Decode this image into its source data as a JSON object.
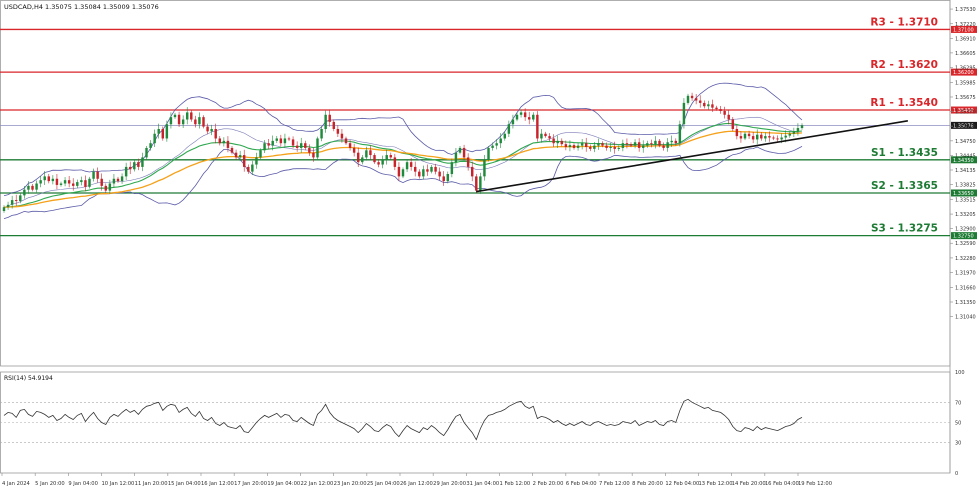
{
  "header": {
    "symbol_ohlc": "USDCAD,H4  1.35075 1.35084 1.35009 1.35076"
  },
  "chart_data": {
    "type": "candlestick",
    "price_axis": {
      "ylim": [
        1.3,
        1.377
      ],
      "ticks": [
        "1.37530",
        "1.37220",
        "1.36910",
        "1.36605",
        "1.36295",
        "1.35985",
        "1.35675",
        "1.35370",
        "1.35060",
        "1.34750",
        "1.34445",
        "1.34135",
        "1.33825",
        "1.33515",
        "1.33205",
        "1.32900",
        "1.32590",
        "1.32280",
        "1.31970",
        "1.31660",
        "1.31350",
        "1.31040"
      ],
      "current_price": "1.35076"
    },
    "levels": [
      {
        "label": "R3 - 1.3710",
        "value": 1.371,
        "tag": "1.37100",
        "kind": "resistance",
        "color": "#d9262a"
      },
      {
        "label": "R2 - 1.3620",
        "value": 1.362,
        "tag": "1.36200",
        "kind": "resistance",
        "color": "#d9262a"
      },
      {
        "label": "R1 - 1.3540",
        "value": 1.354,
        "tag": "1.35400",
        "kind": "resistance",
        "color": "#d9262a"
      },
      {
        "label": "S1 - 1.3435",
        "value": 1.3435,
        "tag": "1.34350",
        "kind": "support",
        "color": "#1e7b34"
      },
      {
        "label": "S2 - 1.3365",
        "value": 1.3365,
        "tag": "1.33650",
        "kind": "support",
        "color": "#1e7b34"
      },
      {
        "label": "S3 - 1.3275",
        "value": 1.3275,
        "tag": "1.32750",
        "kind": "support",
        "color": "#1e7b34"
      }
    ],
    "x_labels": [
      "4 Jan 2024",
      "5 Jan 20:00",
      "9 Jan 04:00",
      "10 Jan 12:00",
      "11 Jan 20:00",
      "15 Jan 04:00",
      "16 Jan 12:00",
      "17 Jan 20:00",
      "19 Jan 04:00",
      "22 Jan 12:00",
      "23 Jan 20:00",
      "25 Jan 04:00",
      "26 Jan 12:00",
      "29 Jan 20:00",
      "31 Jan 04:00",
      "1 Feb 12:00",
      "2 Feb 20:00",
      "6 Feb 04:00",
      "7 Feb 12:00",
      "8 Feb 20:00",
      "12 Feb 04:00",
      "13 Feb 12:00",
      "14 Feb 20:00",
      "16 Feb 04:00",
      "19 Feb 12:00"
    ],
    "closes": [
      1.3335,
      1.334,
      1.335,
      1.3348,
      1.336,
      1.3372,
      1.338,
      1.3372,
      1.3385,
      1.3392,
      1.34,
      1.339,
      1.3395,
      1.3382,
      1.3385,
      1.3392,
      1.3385,
      1.338,
      1.3388,
      1.3392,
      1.3378,
      1.3395,
      1.341,
      1.3395,
      1.338,
      1.337,
      1.3385,
      1.3395,
      1.339,
      1.34,
      1.342,
      1.3415,
      1.343,
      1.342,
      1.344,
      1.346,
      1.347,
      1.349,
      1.35,
      1.348,
      1.351,
      1.3525,
      1.353,
      1.351,
      1.352,
      1.3535,
      1.352,
      1.351,
      1.3525,
      1.3505,
      1.3495,
      1.35,
      1.348,
      1.347,
      1.3475,
      1.346,
      1.345,
      1.344,
      1.3445,
      1.342,
      1.341,
      1.3425,
      1.344,
      1.3455,
      1.347,
      1.3465,
      1.3475,
      1.348,
      1.347,
      1.348,
      1.3478,
      1.3465,
      1.346,
      1.347,
      1.346,
      1.345,
      1.344,
      1.348,
      1.35,
      1.353,
      1.3515,
      1.35,
      1.349,
      1.348,
      1.347,
      1.346,
      1.345,
      1.343,
      1.344,
      1.3455,
      1.3445,
      1.343,
      1.3425,
      1.3435,
      1.3445,
      1.344,
      1.342,
      1.34,
      1.3415,
      1.343,
      1.342,
      1.341,
      1.34,
      1.3415,
      1.341,
      1.342,
      1.341,
      1.34,
      1.339,
      1.3405,
      1.343,
      1.345,
      1.346,
      1.344,
      1.342,
      1.34,
      1.337,
      1.34,
      1.3435,
      1.346,
      1.3465,
      1.347,
      1.348,
      1.349,
      1.351,
      1.352,
      1.353,
      1.3535,
      1.3525,
      1.352,
      1.353,
      1.348,
      1.349,
      1.3485,
      1.348,
      1.347,
      1.3475,
      1.3468,
      1.3462,
      1.3466,
      1.346,
      1.3465,
      1.347,
      1.3462,
      1.3458,
      1.3465,
      1.347,
      1.3465,
      1.346,
      1.3462,
      1.3458,
      1.346,
      1.347,
      1.3468,
      1.3465,
      1.3472,
      1.346,
      1.3465,
      1.347,
      1.3468,
      1.3475,
      1.3465,
      1.346,
      1.3472,
      1.3475,
      1.347,
      1.351,
      1.3555,
      1.357,
      1.3565,
      1.356,
      1.3555,
      1.3548,
      1.3552,
      1.3545,
      1.3542,
      1.3538,
      1.353,
      1.352,
      1.35,
      1.3485,
      1.348,
      1.349,
      1.3485,
      1.3478,
      1.3488,
      1.348,
      1.3485,
      1.3482,
      1.348,
      1.3478,
      1.3482,
      1.3486,
      1.349,
      1.3495,
      1.3502,
      1.3508
    ],
    "rsi": {
      "label": "RSI(14) 54.9194",
      "ylim": [
        0,
        100
      ],
      "ticks": [
        "100",
        "70",
        "50",
        "30",
        "0"
      ],
      "values": [
        57,
        60,
        59,
        55,
        62,
        63,
        58,
        56,
        61,
        60,
        58,
        55,
        57,
        52,
        54,
        58,
        55,
        53,
        57,
        59,
        51,
        56,
        60,
        54,
        50,
        48,
        55,
        58,
        56,
        60,
        63,
        60,
        62,
        58,
        63,
        66,
        67,
        69,
        70,
        62,
        66,
        68,
        67,
        60,
        63,
        65,
        59,
        56,
        61,
        54,
        52,
        55,
        49,
        47,
        50,
        46,
        45,
        44,
        47,
        41,
        40,
        45,
        50,
        54,
        57,
        55,
        57,
        59,
        55,
        58,
        57,
        52,
        51,
        55,
        52,
        49,
        47,
        58,
        62,
        68,
        60,
        55,
        52,
        50,
        48,
        46,
        44,
        40,
        44,
        49,
        46,
        42,
        41,
        45,
        48,
        46,
        40,
        36,
        42,
        47,
        44,
        42,
        40,
        45,
        43,
        47,
        44,
        40,
        37,
        43,
        50,
        56,
        58,
        50,
        45,
        40,
        33,
        44,
        52,
        57,
        58,
        60,
        61,
        63,
        66,
        68,
        70,
        71,
        66,
        64,
        66,
        54,
        56,
        55,
        53,
        50,
        52,
        49,
        47,
        49,
        47,
        49,
        51,
        48,
        47,
        50,
        51,
        49,
        47,
        48,
        47,
        48,
        51,
        50,
        49,
        52,
        47,
        49,
        51,
        50,
        52,
        48,
        47,
        51,
        52,
        50,
        62,
        71,
        73,
        70,
        68,
        66,
        64,
        65,
        62,
        61,
        60,
        57,
        53,
        46,
        42,
        41,
        45,
        44,
        42,
        46,
        43,
        45,
        44,
        43,
        42,
        44,
        46,
        47,
        49,
        53,
        55
      ]
    }
  }
}
